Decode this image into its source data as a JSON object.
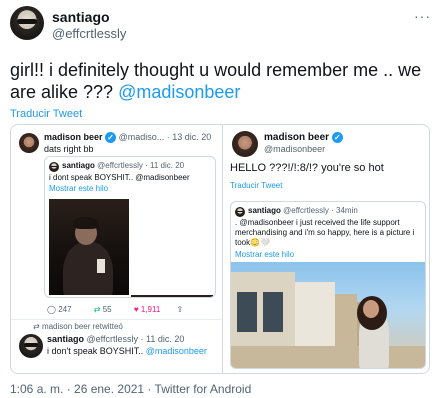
{
  "tweet": {
    "display_name": "santiago",
    "handle": "@effcrtlessly",
    "text": "girl!!  i definitely thought u would remember me .. we are alike ??? ",
    "mention": "@madisonbeer",
    "translate": "Traducir Tweet",
    "footer": "1:06 a. m. · 26 ene. 2021 · Twitter for Android"
  },
  "left_screenshot": {
    "author": "madison beer",
    "meta": "@madiso... · 13 dic. 20",
    "text": "dats right bb",
    "quoted": {
      "author": "santiago",
      "meta": "@effcrtlessly · 11 dic. 20",
      "text": "i dont speak BOYSHIT.. @madisonbeer",
      "show_thread": "Mostrar este hilo"
    },
    "stats": {
      "replies": "247",
      "retweets": "55",
      "likes": "1,911"
    },
    "retweeted_label": "madison beer retwitteó",
    "retweet": {
      "author": "santiago",
      "meta": "@effcrtlessly · 11 dic. 20",
      "text": "i don't speak BOYSHIT.. ",
      "mention": "@madisonbeer"
    }
  },
  "right_screenshot": {
    "author": "madison beer",
    "handle": "@madisonbeer",
    "text": "HELLO ???!/!:8/!? you're so hot",
    "translate": "Traducir Tweet",
    "quoted": {
      "author": "santiago",
      "meta": "@effcrtlessly · 34min",
      "text": ". @madisonbeer i just received the life support merchandising and i'm so happy, here is a picture i took😳🤍",
      "show_thread": "Mostrar este hilo"
    }
  },
  "icons": [
    "more-icon",
    "verified-icon",
    "reply-icon",
    "retweet-icon",
    "like-icon",
    "share-icon",
    "retweet-small-icon"
  ],
  "colors": {
    "accent": "#1d9bf0",
    "like": "#f91880",
    "retweet": "#00ba7c",
    "muted": "#536471"
  }
}
